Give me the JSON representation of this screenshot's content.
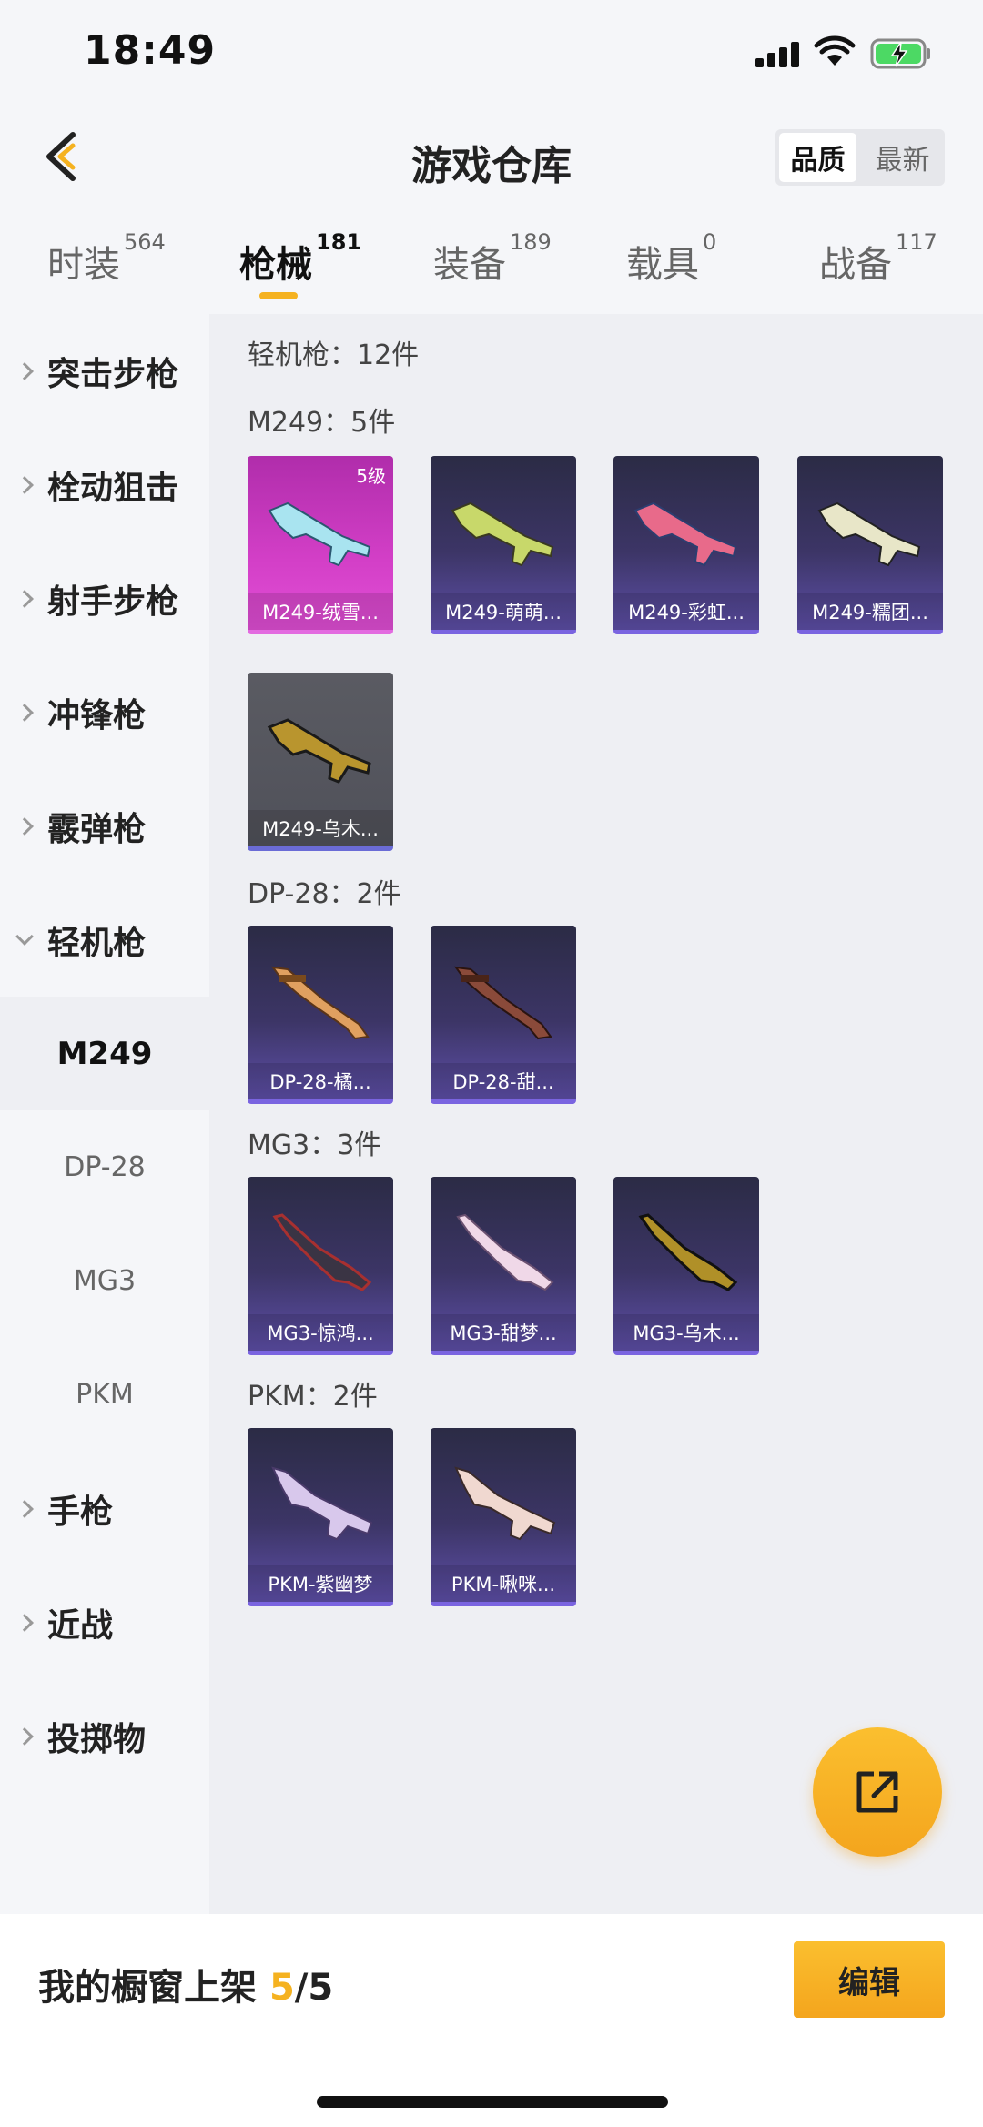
{
  "status_bar": {
    "time": "18:49"
  },
  "nav": {
    "title": "游戏仓库",
    "sort_options": [
      "品质",
      "最新"
    ],
    "sort_selected": "品质"
  },
  "tabs": [
    {
      "label": "时装",
      "count": "564"
    },
    {
      "label": "枪械",
      "count": "181"
    },
    {
      "label": "装备",
      "count": "189"
    },
    {
      "label": "载具",
      "count": "0"
    },
    {
      "label": "战备",
      "count": "117"
    }
  ],
  "sidebar": {
    "categories": [
      "突击步枪",
      "栓动狙击",
      "射手步枪",
      "冲锋枪",
      "霰弹枪",
      "轻机枪"
    ],
    "sub_items": [
      "M249",
      "DP-28",
      "MG3",
      "PKM"
    ],
    "tail_categories": [
      "手枪",
      "近战",
      "投掷物"
    ]
  },
  "content": {
    "category_summary": "轻机枪：12件",
    "groups": [
      {
        "header": "M249：5件",
        "items": [
          {
            "name": "M249-绒雪...",
            "level": "5级",
            "rarity": "pink"
          },
          {
            "name": "M249-萌萌...",
            "rarity": "purple"
          },
          {
            "name": "M249-彩虹...",
            "rarity": "purple"
          },
          {
            "name": "M249-糯团...",
            "rarity": "purple"
          },
          {
            "name": "M249-乌木...",
            "rarity": "grey"
          }
        ]
      },
      {
        "header": "DP-28：2件",
        "items": [
          {
            "name": "DP-28-橘...",
            "rarity": "purple"
          },
          {
            "name": "DP-28-甜...",
            "rarity": "purple"
          }
        ]
      },
      {
        "header": "MG3：3件",
        "items": [
          {
            "name": "MG3-惊鸿...",
            "rarity": "purple"
          },
          {
            "name": "MG3-甜梦...",
            "rarity": "purple"
          },
          {
            "name": "MG3-乌木...",
            "rarity": "purple"
          }
        ]
      },
      {
        "header": "PKM：2件",
        "items": [
          {
            "name": "PKM-紫幽梦",
            "rarity": "purple"
          },
          {
            "name": "PKM-啾咪...",
            "rarity": "purple"
          }
        ]
      }
    ]
  },
  "bottom": {
    "showcase_label": "我的橱窗上架",
    "showcase_current": "5",
    "showcase_total": "/5",
    "edit_label": "编辑"
  },
  "colors": {
    "accent": "#f5b220",
    "purple_card": "#3c3566",
    "pink_card": "#d33fc7"
  }
}
